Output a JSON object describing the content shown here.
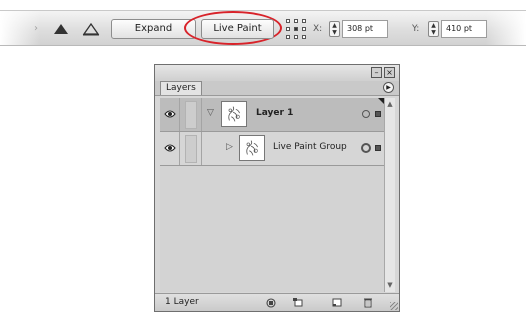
{
  "control_bar": {
    "expand_label": "Expand",
    "live_paint_label": "Live Paint",
    "x_label": "X:",
    "x_value": "308 pt",
    "y_label": "Y:",
    "y_value": "410 pt",
    "highlight_color": "#d8232a"
  },
  "layers_panel": {
    "tab_label": "Layers",
    "layers": [
      {
        "name": "Layer 1",
        "expanded": true,
        "selected": true
      },
      {
        "name": "Live Paint Group",
        "expanded": false,
        "selected": false
      }
    ],
    "layer_count": "1 Layer"
  }
}
